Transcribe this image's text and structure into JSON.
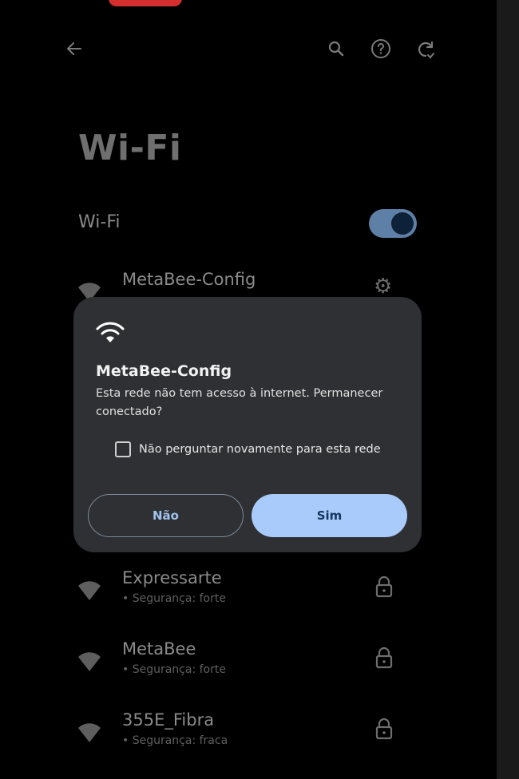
{
  "header": {
    "back_icon": "arrow-left-icon",
    "search_icon": "search-icon",
    "help_icon": "help-circle-icon",
    "refresh_icon": "refresh-icon"
  },
  "page": {
    "title": "Wi-Fi",
    "toggle_label": "Wi-Fi",
    "toggle_on": true
  },
  "networks": [
    {
      "name": "MetaBee-Config",
      "sub": "",
      "trailing": "gear-icon"
    },
    {
      "name": "Expressarte",
      "sub": "• Segurança: forte",
      "trailing": "lock-icon"
    },
    {
      "name": "MetaBee",
      "sub": "• Segurança: forte",
      "trailing": "lock-icon"
    },
    {
      "name": "355E_Fibra",
      "sub": "• Segurança: fraca",
      "trailing": "lock-icon"
    }
  ],
  "dialog": {
    "icon": "wifi-icon",
    "title": "MetaBee-Config",
    "message": "Esta rede não tem acesso à internet. Permanecer conectado?",
    "checkbox_label": "Não perguntar novamente para esta rede",
    "checkbox_checked": false,
    "no_label": "Não",
    "yes_label": "Sim"
  },
  "colors": {
    "accent": "#a9cbfb",
    "dialog_bg": "#2e3033",
    "background": "#000000"
  }
}
